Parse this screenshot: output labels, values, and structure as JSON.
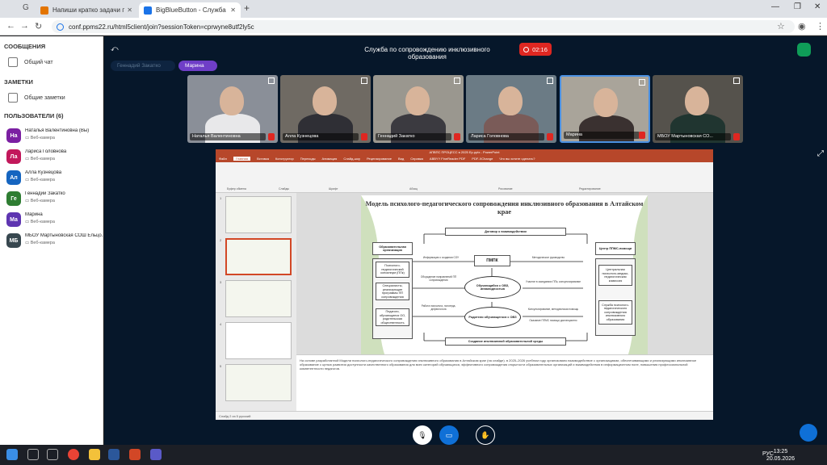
{
  "browser": {
    "tabs": [
      {
        "title": "Напиши кратко задачи просв"
      },
      {
        "title": "BigBlueButton - Служба по"
      }
    ],
    "url": "conf.ppms22.ru/html5client/join?sessionToken=cprwyne8utf2ly5c"
  },
  "sidebar": {
    "messages_heading": "СООБЩЕНИЯ",
    "public_chat": "Общий чат",
    "notes_heading": "ЗАМЕТКИ",
    "shared_notes": "Общие заметки",
    "users_heading": "ПОЛЬЗОВАТЕЛИ (6)",
    "users": [
      {
        "initials": "На",
        "name": "Наталья Валентиновна (Вы)",
        "status": "Веб-камера",
        "color": "#7b1fa2"
      },
      {
        "initials": "Ла",
        "name": "Лариса Головнова",
        "status": "Веб-камера",
        "color": "#c2185b"
      },
      {
        "initials": "Ал",
        "name": "Алла Кузнецова",
        "status": "Веб-камера",
        "color": "#1565c0"
      },
      {
        "initials": "Ге",
        "name": "Геннадий Закатко",
        "status": "Веб-камера",
        "color": "#2e7d32"
      },
      {
        "initials": "Ма",
        "name": "Марина",
        "status": "Веб-камера",
        "color": "#5e35b1"
      },
      {
        "initials": "МБ",
        "name": "МБОУ Мартыновская СОШ Ельцо...",
        "status": "Веб-камера",
        "color": "#37474f"
      }
    ]
  },
  "meeting": {
    "title": "Служба по сопровождению инклюзивного образования",
    "timer": "02:16",
    "talkers": [
      "Геннадий Закатко",
      "Марина"
    ]
  },
  "tiles": [
    {
      "name": "Наталья Валентиновна",
      "bg": "#8a8f98",
      "shirt": "#e8e8ea"
    },
    {
      "name": "Алла Кузнецова",
      "bg": "#6f6a63",
      "shirt": "#2f2f35"
    },
    {
      "name": "Геннадий Закатко",
      "bg": "#9a978f",
      "shirt": "#3b3a40"
    },
    {
      "name": "Лариса Головнова",
      "bg": "#6b7b85",
      "shirt": "#7a5b58"
    },
    {
      "name": "Марина",
      "bg": "#a9a49a",
      "shirt": "#3a3130"
    },
    {
      "name": "МБОУ Мартыновская СО...",
      "bg": "#55524c",
      "shirt": "#203530"
    }
  ],
  "ppt": {
    "title_bar": "АПВПС ПРОЦЕСС в 2025 Ер.pptx - PowerPoint",
    "menu": [
      "Файл",
      "Главная",
      "Вставка",
      "Конструктор",
      "Переходы",
      "Анимация",
      "Слайд-шоу",
      "Рецензирование",
      "Вид",
      "Справка",
      "ABBYY FineReader PDF",
      "PDF-XChange",
      "Что вы хотите сделать?"
    ],
    "ribbon_groups": [
      "Буфер обмена",
      "Слайды",
      "Шрифт",
      "Абзац",
      "Рисование",
      "Редактирование"
    ],
    "status": "Слайд 2 из 5    русский",
    "notes": "На основе разработанной Модели психолого-педагогического сопровождения инклюзивного образования в Алтайском крае (на слайде). в 2025–2026 учебном году организовано взаимодействие с организациями, обеспечивающими и реализующими инклюзивное образование с целью развития доступности качественного образования для всех категорий обучающихся, эффективного сопровождения открытости образовательных организаций и взаимодействия в информационном поле, повышения профессиональной компетентности педагогов."
  },
  "slide": {
    "title": "Модель психолого-педагогического сопровождения инклюзивного образования в Алтайском крае",
    "agreement": "Договор о взаимодействии",
    "edu_org": "Образовательная организация",
    "center": "Центр ППМС-помощи",
    "pmpk": "ПМПК",
    "left_boxes": [
      "Психолого-педагогический консилиум (ППк)",
      "Специалисты, реализующие программы ПП сопровождения",
      "Педагоги, обучающиеся ОО, родительская общественность"
    ],
    "right_boxes": [
      "Центральная психолого-медико-педагогическая комиссия",
      "Служба психолого-педагогического сопровождения инклюзивного образования"
    ],
    "ovals": [
      "Обучающийся с ОВЗ, инвалидностью",
      "Родители обучающегося с ОВЗ"
    ],
    "labels": [
      "Информация о создании СОУ",
      "Методическое руководство",
      "Обсуждение направлений ПП сопровождения",
      "Участие в заседаниях ППк, консультирование",
      "Работа психолога, логопеда, дефектолога",
      "Консультирование, методическая помощь",
      "Оказание ППМС помощи дистанционно"
    ],
    "bottom": "Создание инклюзивной образовательной среды"
  },
  "taskbar": {
    "time": "13:25",
    "date": "20.05.2026",
    "lang": "РУС"
  }
}
